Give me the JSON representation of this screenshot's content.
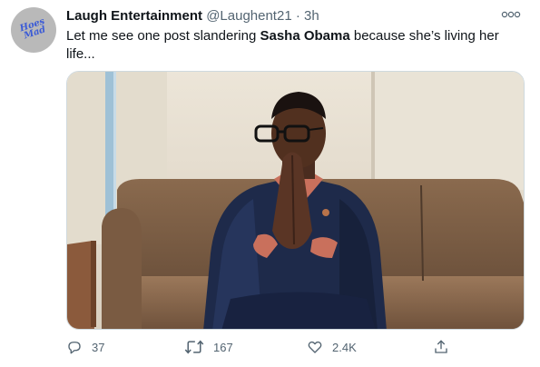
{
  "tweet": {
    "avatar_text": "Hoes Mad",
    "display_name": "Laugh Entertainment",
    "handle": "@Laughent21",
    "separator": "·",
    "time": "3h",
    "text_before": "Let me see one post slandering ",
    "text_bold": "Sasha Obama",
    "text_after": " because she’s living her life...",
    "media_icon": "photo-man-praying-hands",
    "actions": {
      "reply": {
        "icon": "reply-icon",
        "count": "37"
      },
      "retweet": {
        "icon": "retweet-icon",
        "count": "167"
      },
      "like": {
        "icon": "heart-icon",
        "count": "2.4K"
      },
      "share": {
        "icon": "share-icon"
      }
    }
  },
  "colors": {
    "text_primary": "#0f1419",
    "text_secondary": "#536471",
    "border": "#cfd9de"
  }
}
